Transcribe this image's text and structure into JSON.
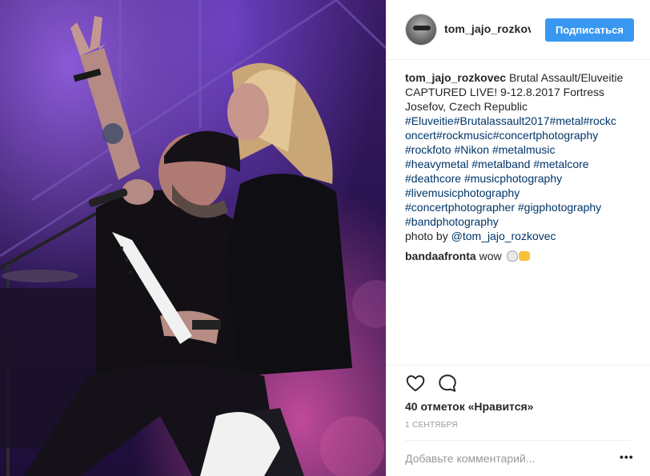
{
  "post": {
    "username": "tom_jajo_rozkovec",
    "follow_label": "Подписаться",
    "photo_alt": "",
    "caption": {
      "author": "tom_jajo_rozkovec",
      "lines": [
        " Brutal Assault/Eluveitie",
        "CAPTURED LIVE! 9-12.8.2017 Fortress",
        "Josefov, Czech Republic"
      ],
      "hashtag_lines": [
        "#Eluveitie#Brutalassault2017#metal#rockc",
        "oncert#rockmusic#concertphotography",
        "#rockfoto #Nikon #metalmusic",
        "#heavymetal #metalband #metalcore",
        "#deathcore #musicphotography",
        "#livemusicphotography",
        "#concertphotographer #gigphotography",
        "#bandphotography"
      ],
      "credit_prefix": "photo by ",
      "credit_mention": "@tom_jajo_rozkovec"
    },
    "comment": {
      "author": "bandaafronta",
      "text": " wow "
    },
    "likes": "40 отметок «Нравится»",
    "date": "1 СЕНТЯБРЯ",
    "comment_placeholder": "Добавьте комментарий...",
    "more_label": "•••"
  },
  "icons": {
    "like": "heart-icon",
    "comment": "comment-bubble-icon",
    "more": "more-options-icon"
  },
  "colors": {
    "accent": "#3897f0",
    "hashtag": "#003569",
    "text": "#262626",
    "muted": "#999999"
  }
}
